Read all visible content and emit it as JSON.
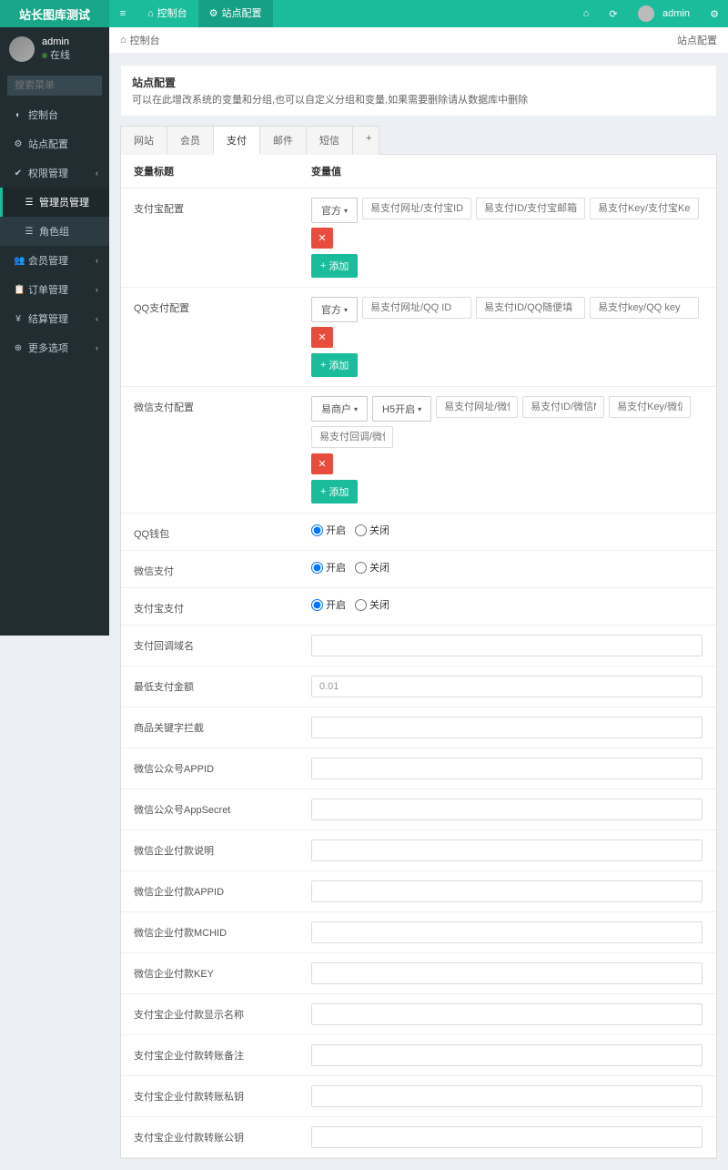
{
  "header": {
    "logo": "站长图库测试",
    "tabs": [
      {
        "icon": "●",
        "label": "控制台"
      },
      {
        "icon": "●",
        "label": "站点配置"
      }
    ],
    "user": "admin"
  },
  "sidebar": {
    "user": {
      "name": "admin",
      "status": "在线"
    },
    "search_placeholder": "搜索菜单",
    "items": [
      {
        "icon": "◐",
        "label": "控制台"
      },
      {
        "icon": "⚙",
        "label": "站点配置"
      },
      {
        "icon": "✔",
        "label": "权限管理",
        "arrow": true
      },
      {
        "icon": "☰",
        "label": "管理员管理",
        "sub": true,
        "active": true
      },
      {
        "icon": "☰",
        "label": "角色组",
        "sub": true
      },
      {
        "icon": "👥",
        "label": "会员管理",
        "arrow": true
      },
      {
        "icon": "📋",
        "label": "订单管理",
        "arrow": true
      },
      {
        "icon": "¥",
        "label": "结算管理",
        "arrow": true
      },
      {
        "icon": "⊕",
        "label": "更多选项",
        "arrow": true
      }
    ]
  },
  "breadcrumb": {
    "left": "控制台",
    "right": "站点配置"
  },
  "desc": {
    "title": "站点配置",
    "text": "可以在此增改系统的变量和分组,也可以自定义分组和变量,如果需要删除请从数据库中删除"
  },
  "config_tabs": [
    "网站",
    "会员",
    "支付",
    "邮件",
    "短信"
  ],
  "columns": {
    "label": "变量标题",
    "value": "变量值"
  },
  "rows": {
    "alipay": {
      "label": "支付宝配置",
      "dropdown": "官方",
      "inputs": [
        "易支付网址/支付宝ID",
        "易支付ID/支付宝邮箱",
        "易支付Key/支付宝Key"
      ],
      "add": "添加"
    },
    "qqpay": {
      "label": "QQ支付配置",
      "dropdown": "官方",
      "inputs": [
        "易支付网址/QQ ID",
        "易支付ID/QQ随便填",
        "易支付key/QQ key"
      ],
      "add": "添加"
    },
    "wxpay": {
      "label": "微信支付配置",
      "dd1": "易商户",
      "dd2": "H5开启",
      "inputs": [
        "易支付网址/微信APPID/易支",
        "易支付ID/微信MCHID/易商/",
        "易支付Key/微信KEY/易商户",
        "易支付回调/微信AppSecret"
      ],
      "add": "添加"
    },
    "radios": [
      {
        "label": "QQ钱包",
        "on": "开启",
        "off": "关闭"
      },
      {
        "label": "微信支付",
        "on": "开启",
        "off": "关闭"
      },
      {
        "label": "支付宝支付",
        "on": "开启",
        "off": "关闭"
      }
    ],
    "simple": [
      {
        "label": "支付回调域名",
        "value": ""
      },
      {
        "label": "最低支付金额",
        "value": "0.01"
      },
      {
        "label": "商品关键字拦截",
        "value": ""
      },
      {
        "label": "微信公众号APPID",
        "value": ""
      },
      {
        "label": "微信公众号AppSecret",
        "value": ""
      },
      {
        "label": "微信企业付款说明",
        "value": ""
      },
      {
        "label": "微信企业付款APPID",
        "value": ""
      },
      {
        "label": "微信企业付款MCHID",
        "value": ""
      },
      {
        "label": "微信企业付款KEY",
        "value": ""
      },
      {
        "label": "支付宝企业付款显示名称",
        "value": ""
      },
      {
        "label": "支付宝企业付款转账备注",
        "value": ""
      },
      {
        "label": "支付宝企业付款转账私钥",
        "value": ""
      },
      {
        "label": "支付宝企业付款转账公钥",
        "value": ""
      }
    ]
  }
}
